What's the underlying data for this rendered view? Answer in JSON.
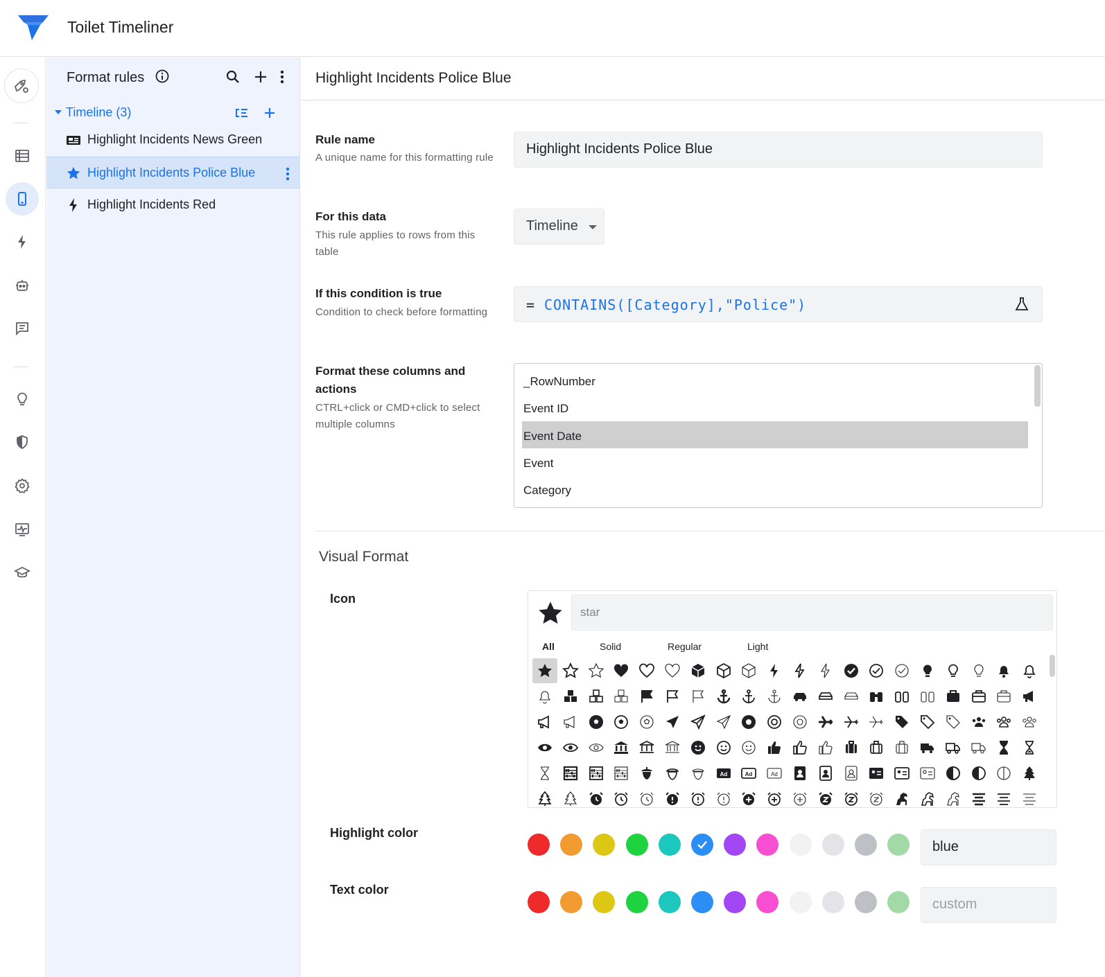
{
  "app": {
    "title": "Toilet Timeliner"
  },
  "rail": {
    "items": [
      {
        "name": "rocket-gear-icon"
      },
      {
        "name": "table-icon"
      },
      {
        "name": "mobile-icon"
      },
      {
        "name": "bolt-icon"
      },
      {
        "name": "robot-icon"
      },
      {
        "name": "chat-icon"
      },
      {
        "name": "lightbulb-icon"
      },
      {
        "name": "shield-icon"
      },
      {
        "name": "settings-icon"
      },
      {
        "name": "monitor-activity-icon"
      },
      {
        "name": "graduation-cap-icon"
      }
    ],
    "active": "mobile-icon"
  },
  "tree": {
    "title": "Format rules",
    "group_label": "Timeline (3)",
    "items": [
      {
        "label": "Highlight Incidents News Green",
        "icon": "newspaper-icon"
      },
      {
        "label": "Highlight Incidents Police Blue",
        "icon": "star-icon",
        "selected": true
      },
      {
        "label": "Highlight Incidents Red",
        "icon": "bolt-icon"
      }
    ]
  },
  "main": {
    "title": "Highlight Incidents Police Blue",
    "rule_name": {
      "label": "Rule name",
      "help": "A unique name for this formatting rule",
      "value": "Highlight Incidents Police Blue"
    },
    "for_data": {
      "label": "For this data",
      "help": "This rule applies to rows from this table",
      "value": "Timeline"
    },
    "condition": {
      "label": "If this condition is true",
      "help": "Condition to check before formatting",
      "eq": "=",
      "expression": "CONTAINS([Category],\"Police\")"
    },
    "columns": {
      "label": "Format these columns and actions",
      "help": "CTRL+click or CMD+click to select multiple columns",
      "options": [
        "_RowNumber",
        "Event ID",
        "Event Date",
        "Event",
        "Category"
      ],
      "selected": "Event Date"
    },
    "visual_format": {
      "title": "Visual Format",
      "icon": {
        "label": "Icon",
        "search_value": "",
        "search_placeholder": "star",
        "tabs": [
          "All",
          "Solid",
          "Regular",
          "Light"
        ],
        "active_tab": "All",
        "selected_icon": "star-solid"
      },
      "highlight_color": {
        "label": "Highlight color",
        "value": "blue",
        "selected_index": 5
      },
      "text_color": {
        "label": "Text color",
        "value": "",
        "placeholder": "custom"
      },
      "swatches": [
        "#ee2a2a",
        "#f29b30",
        "#ddc715",
        "#1ed33f",
        "#1cc8bd",
        "#2b8ef4",
        "#a347f5",
        "#f84ed2",
        "#f1f2f3",
        "#e2e4e7",
        "#bdc0c4",
        "#a3d9a6"
      ]
    }
  }
}
